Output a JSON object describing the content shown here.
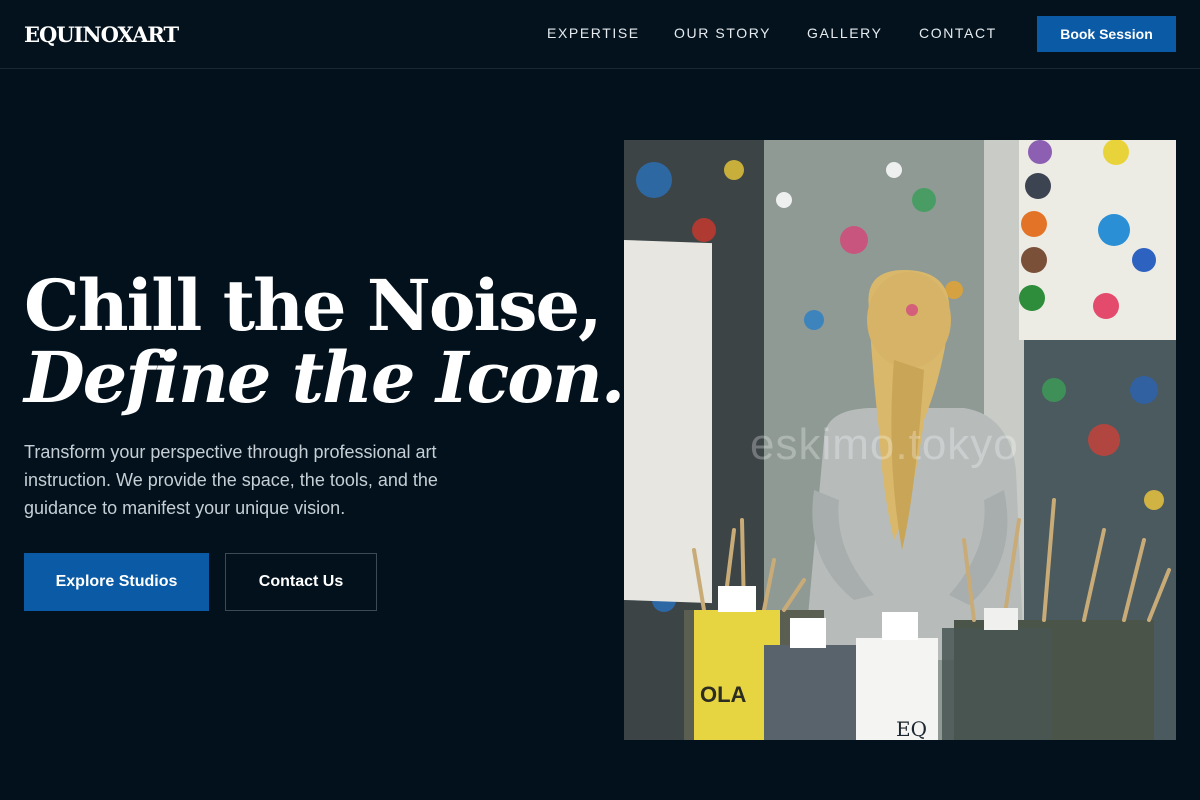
{
  "brand": {
    "logo_text": "EQUINOXART"
  },
  "nav": {
    "items": [
      {
        "label": "EXPERTISE"
      },
      {
        "label": "OUR STORY"
      },
      {
        "label": "GALLERY"
      },
      {
        "label": "CONTACT"
      }
    ],
    "cta_label": "Book Session"
  },
  "hero": {
    "title_line1": "Chill the Noise,",
    "title_line2": "Define the Icon.",
    "description": "Transform your perspective through professional art instruction. We provide the space, the tools, and the guidance to manifest your unique vision.",
    "primary_button": "Explore Studios",
    "secondary_button": "Contact Us",
    "image": {
      "watermark": "eskimo.tokyo",
      "paint_labels": [
        "OLA",
        "EQ"
      ]
    }
  },
  "colors": {
    "background": "#02111c",
    "accent": "#0a5aa5",
    "text_muted": "#c6cfd6"
  }
}
